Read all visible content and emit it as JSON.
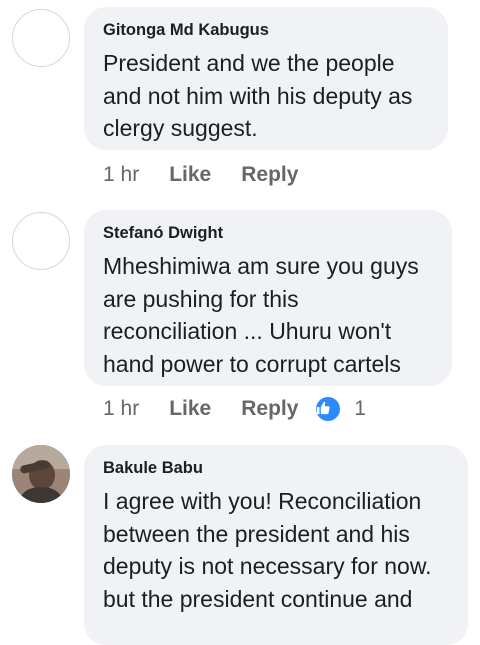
{
  "comments": [
    {
      "author": "Gitonga Md Kabugus",
      "text": "President and we the people and not him with his deputy as clergy suggest.",
      "time": "1 hr",
      "like_label": "Like",
      "reply_label": "Reply"
    },
    {
      "author": "Stefanó Dwight",
      "text": "Mheshimiwa am sure you guys are pushing for this reconciliation ... Uhuru won't hand power to corrupt cartels",
      "time": "1 hr",
      "like_label": "Like",
      "reply_label": "Reply",
      "reaction_icon": "thumbs-up-icon",
      "reaction_count": "1",
      "reaction_color": "#2e89ff"
    },
    {
      "author": "Bakule Babu",
      "text": "I agree with  you! Reconciliation between the president and his deputy is not necessary for now. but the president continue and"
    }
  ]
}
